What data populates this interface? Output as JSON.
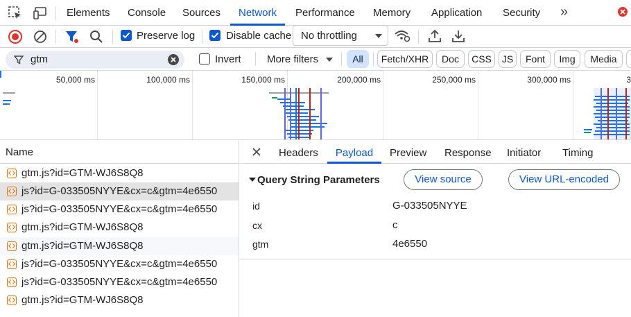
{
  "tabs": [
    {
      "label": "Elements"
    },
    {
      "label": "Console"
    },
    {
      "label": "Sources"
    },
    {
      "label": "Network",
      "active": true
    },
    {
      "label": "Performance"
    },
    {
      "label": "Memory"
    },
    {
      "label": "Application"
    },
    {
      "label": "Security"
    }
  ],
  "toolbar": {
    "preserve_log": "Preserve log",
    "disable_cache": "Disable cache",
    "throttling": "No throttling"
  },
  "filter": {
    "value": "gtm",
    "invert": "Invert",
    "more_filters": "More filters",
    "types": [
      "All",
      "Fetch/XHR",
      "Doc",
      "CSS",
      "JS",
      "Font",
      "Img",
      "Media"
    ]
  },
  "overview": {
    "ticks": [
      "50,000 ms",
      "100,000 ms",
      "150,000 ms",
      "200,000 ms",
      "250,000 ms",
      "300,000 ms",
      "3"
    ]
  },
  "requests": {
    "header": "Name",
    "items": [
      "gtm.js?id=GTM-WJ6S8Q8",
      "js?id=G-033505NYYE&cx=c&gtm=4e6550",
      "js?id=G-033505NYYE&cx=c&gtm=4e6550",
      "gtm.js?id=GTM-WJ6S8Q8",
      "gtm.js?id=GTM-WJ6S8Q8",
      "js?id=G-033505NYYE&cx=c&gtm=4e6550",
      "js?id=G-033505NYYE&cx=c&gtm=4e6550",
      "gtm.js?id=GTM-WJ6S8Q8"
    ]
  },
  "detail": {
    "tabs": [
      "Headers",
      "Payload",
      "Preview",
      "Response",
      "Initiator",
      "Timing"
    ],
    "section_title": "Query String Parameters",
    "view_source": "View source",
    "view_url_encoded": "View URL-encoded",
    "params": [
      {
        "key": "id",
        "value": "G-033505NYYE"
      },
      {
        "key": "cx",
        "value": "c"
      },
      {
        "key": "gtm",
        "value": "4e6550"
      }
    ]
  },
  "colors": {
    "accent": "#0b57d0",
    "record": "#dc362e",
    "selected_row": "#e3e3e3",
    "chip_active": "#d3e3fd"
  }
}
